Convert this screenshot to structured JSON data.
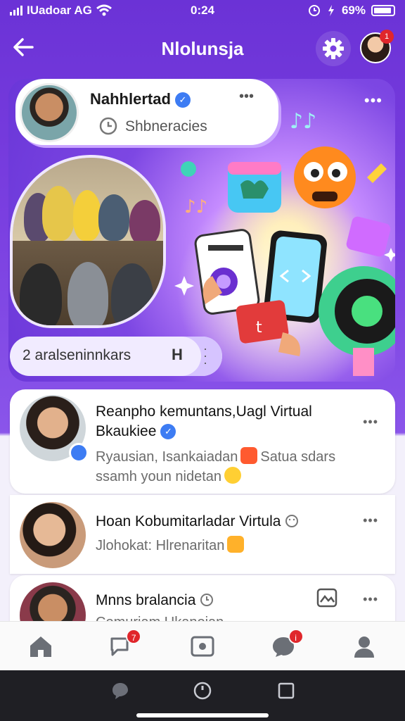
{
  "status_bar": {
    "carrier": "IUadoar AG",
    "time": "0:24",
    "battery": "69%"
  },
  "header": {
    "title": "Nlolunsja",
    "back_icon": "back-arrow-icon",
    "settings_icon": "gear-icon",
    "notification_count": "1"
  },
  "hero": {
    "profile": {
      "name": "Nahhlertad",
      "subtitle": "Shbneracies",
      "more": "•••"
    },
    "more": "•••",
    "input": {
      "text": "2 aralseninnkars",
      "trailing": "H"
    }
  },
  "feed": {
    "items": [
      {
        "title_line1": "Reanpho kemuntans,Uagl Virtual",
        "title_line2": "Bkaukiee",
        "verified": true,
        "sub_line1": "Ryausian, Isankaiadan",
        "sub_line1_after": "Satua sdars",
        "sub_line2": "ssamh youn nidetan",
        "more": "•••"
      },
      {
        "title": "Hoan Kobumitarladar Virtula",
        "sub": "Jlohokat: Hlrenaritan",
        "more": "•••"
      },
      {
        "title": "Mnns bralancia",
        "sub": "Comuriam Ukanoian",
        "more": "•••"
      }
    ]
  },
  "bottom_nav": {
    "items": [
      {
        "icon": "home-icon"
      },
      {
        "icon": "chat-icon",
        "badge": "7"
      },
      {
        "icon": "photo-icon"
      },
      {
        "icon": "message-icon",
        "badge": "i"
      },
      {
        "icon": "profile-icon"
      }
    ]
  },
  "colors": {
    "accent": "#6b32d6",
    "badge": "#e0262b",
    "verified": "#3d7cf3"
  }
}
